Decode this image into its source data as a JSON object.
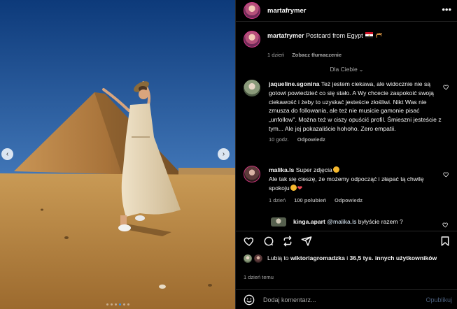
{
  "header": {
    "username": "martafrymer",
    "more_icon": "more-horizontal-icon"
  },
  "caption": {
    "username": "martafrymer",
    "text": "Postcard from Egypt",
    "emojis": [
      "egypt-flag",
      "camel"
    ],
    "time": "1 dzień",
    "translate": "Zobacz tłumaczenie"
  },
  "sort": {
    "label": "Dla Ciebie"
  },
  "comments": [
    {
      "username": "jaqueline.sgonina",
      "text": "Też jestem ciekawa, ale widocznie nie są gotowi powiedzieć co się stało. A Wy chcecie zaspokoić swoją ciekawość i żeby to uzyskać jesteście złośliwi. Nikt Was nie zmusza do followania, ale też nie musicie gamonie pisać „unfollow\". Można też w ciszy opuścić profil. Śmieszni jesteście z tym... Ale jej pokazaliście hohoho. Zero empatii.",
      "time": "10 godz.",
      "reply": "Odpowiedz"
    },
    {
      "username": "malika.ls",
      "text_line1": "Super zdjęcia",
      "text_line2": "Ale tak się cieszę, że możemy odpocząć i złapać tą chwilę spokoju",
      "time": "1 dzień",
      "likes": "100 polubień",
      "reply": "Odpowiedz"
    },
    {
      "username": "kinga.apart",
      "mention": "@malika.ls",
      "text": "byłyście razem ?"
    }
  ],
  "likes": {
    "prefix": "Lubią to",
    "user": "wiktoriagromadzka",
    "middle": "i",
    "count": "36,5 tys. innych użytkowników"
  },
  "time_ago": "1 dzień temu",
  "add_comment": {
    "placeholder": "Dodaj komentarz...",
    "publish": "Opublikuj"
  },
  "carousel": {
    "current_slide": 4,
    "total_slides": 6
  },
  "colors": {
    "background": "#000000",
    "muted": "#a8a8a8",
    "accent": "#3897f0",
    "like_red": "#ed4956"
  }
}
